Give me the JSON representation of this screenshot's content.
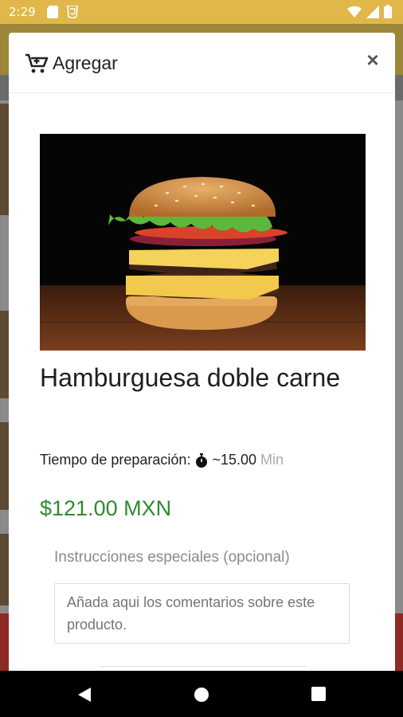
{
  "status_bar": {
    "time": "2:29"
  },
  "modal": {
    "title": "Agregar",
    "close_label": "×"
  },
  "product": {
    "name": "Hamburguesa doble carne",
    "prep_label": "Tiempo de preparación:",
    "prep_value": "~15.00",
    "prep_unit": "Min",
    "price": "$121.00 MXN"
  },
  "instructions": {
    "label": "Instrucciones especiales (opcional)",
    "placeholder": "Añada aqui los comentarios sobre este producto.",
    "value": ""
  },
  "icons": {
    "cart": "cart-plus-icon",
    "timer": "stopwatch-icon",
    "back": "back-icon",
    "home": "home-icon",
    "recents": "recents-icon"
  },
  "colors": {
    "status_bar": "#e0b84a",
    "price": "#2e8b2e",
    "brand_red": "#8c2a23"
  }
}
